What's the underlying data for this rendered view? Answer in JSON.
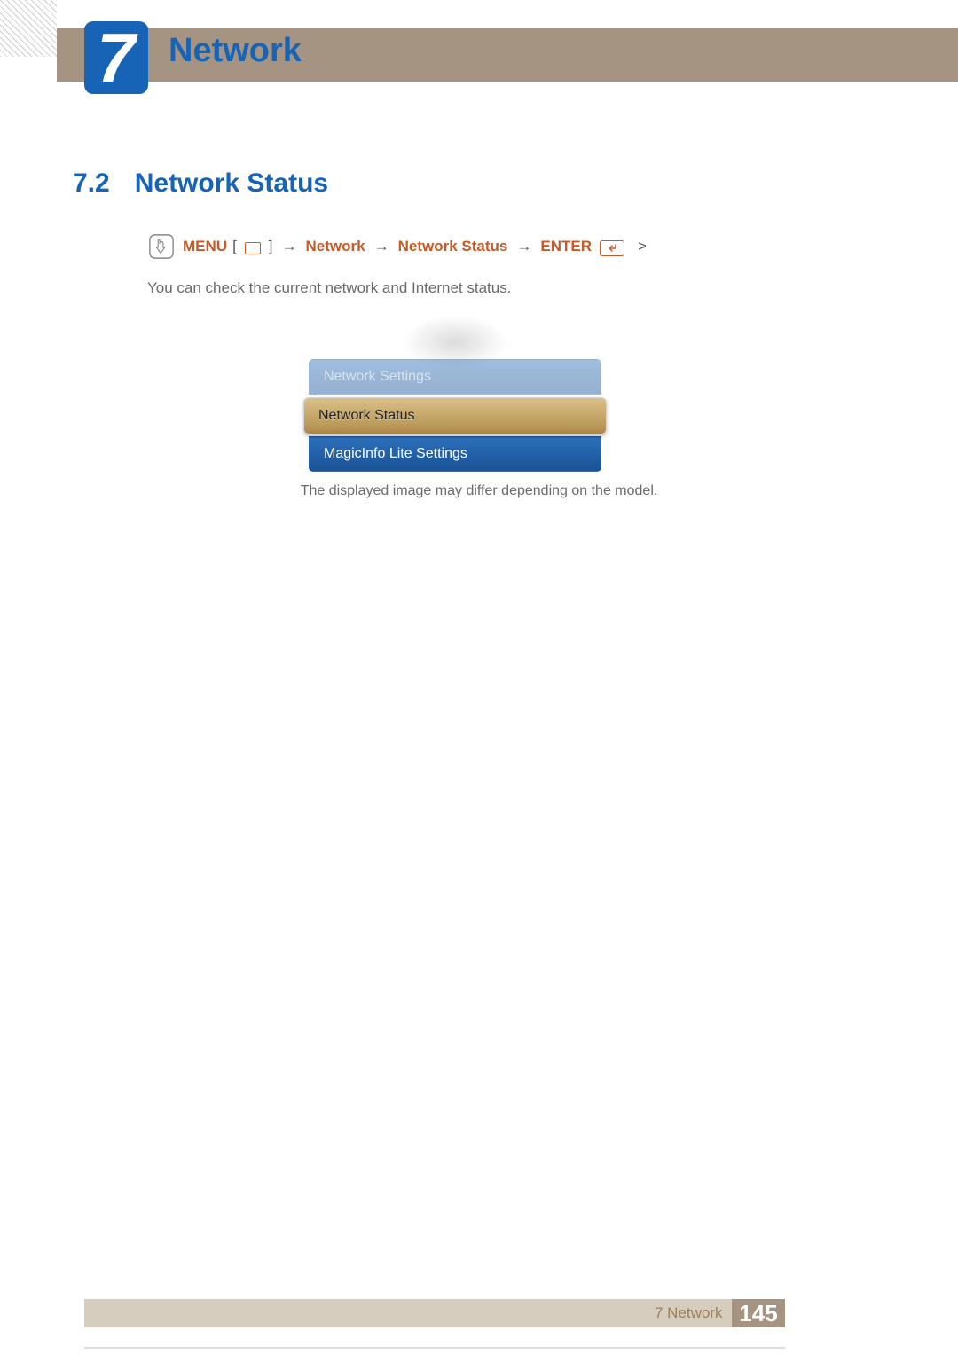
{
  "chapter": {
    "number": "7",
    "title": "Network"
  },
  "section": {
    "number": "7.2",
    "title": "Network Status"
  },
  "nav": {
    "menu_label": "MENU",
    "bracket_open": "[",
    "bracket_close": "]",
    "arrow": "→",
    "item1": "Network",
    "item2": "Network Status",
    "enter_label": "ENTER",
    "gt": ">"
  },
  "description": "You can check the current network and Internet status.",
  "menu": {
    "items": [
      {
        "label": "Network Settings",
        "state": "faded"
      },
      {
        "label": "Network Status",
        "state": "selected"
      },
      {
        "label": "MagicInfo Lite Settings",
        "state": "normal"
      }
    ]
  },
  "caption": "The displayed image may differ depending on the model.",
  "footer": {
    "label": "7 Network",
    "page": "145"
  }
}
